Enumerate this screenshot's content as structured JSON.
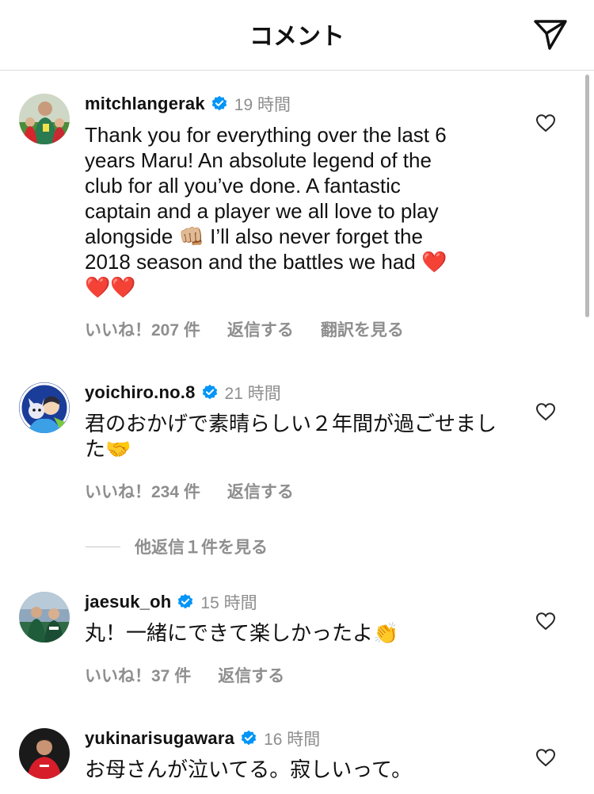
{
  "header": {
    "title": "コメント",
    "share_icon": "paper-plane-icon"
  },
  "comments": [
    {
      "username": "mitchlangerak",
      "verified": true,
      "time": "19 時間",
      "text_lines": [
        "Thank you for everything over the last 6",
        "years Maru! An absolute legend of the",
        "club for all you’ve done. A fantastic",
        "captain and a player we all love to play",
        "alongside 👊🏼 I’ll also never forget the",
        "2018 season and the battles we had ❤️",
        "❤️❤️"
      ],
      "likes": "いいね！207 件",
      "reply": "返信する",
      "translate": "翻訳を見る"
    },
    {
      "username": "yoichiro.no.8",
      "verified": true,
      "time": "21 時間",
      "text_lines": [
        "君のおかげで素晴らしい２年間が過ごせまし",
        "た🤝"
      ],
      "likes": "いいね！234 件",
      "reply": "返信する"
    },
    {
      "username": "jaesuk_oh",
      "verified": true,
      "time": "15 時間",
      "text_lines": [
        "丸！一緒にできて楽しかったよ👏"
      ],
      "likes": "いいね！37 件",
      "reply": "返信する"
    },
    {
      "username": "yukinarisugawara",
      "verified": true,
      "time": "16 時間",
      "text_lines": [
        "お母さんが泣いてる。寂しいって。"
      ]
    }
  ],
  "more_replies": "他返信１件を見る",
  "colors": {
    "verified": "#0095f6",
    "secondary_text": "#8e8e8e",
    "divider": "#dbdbdb"
  }
}
